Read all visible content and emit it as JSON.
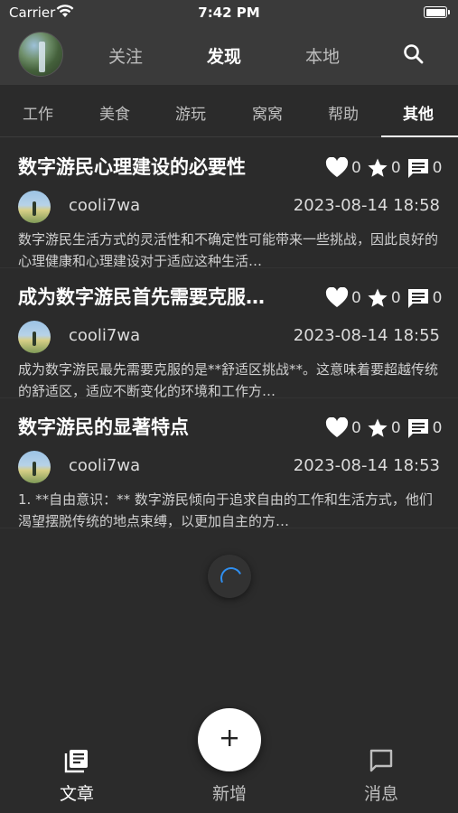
{
  "status_bar": {
    "carrier": "Carrier",
    "time": "7:42 PM"
  },
  "header": {
    "tabs": [
      {
        "label": "关注",
        "active": false
      },
      {
        "label": "发现",
        "active": true
      },
      {
        "label": "本地",
        "active": false
      }
    ],
    "search_icon": "search-icon"
  },
  "categories": [
    {
      "label": "工作",
      "active": false
    },
    {
      "label": "美食",
      "active": false
    },
    {
      "label": "游玩",
      "active": false
    },
    {
      "label": "窝窝",
      "active": false
    },
    {
      "label": "帮助",
      "active": false
    },
    {
      "label": "其他",
      "active": true
    }
  ],
  "articles": [
    {
      "title": "数字游民心理建设的必要性",
      "likes": "0",
      "stars": "0",
      "comments": "0",
      "author": "cooli7wa",
      "date": "2023-08-14 18:58",
      "excerpt": "数字游民生活方式的灵活性和不确定性可能带来一些挑战，因此良好的心理健康和心理建设对于适应这种生活…"
    },
    {
      "title": "成为数字游民首先需要克服…",
      "likes": "0",
      "stars": "0",
      "comments": "0",
      "author": "cooli7wa",
      "date": "2023-08-14 18:55",
      "excerpt": "成为数字游民最先需要克服的是**舒适区挑战**。这意味着要超越传统的舒适区，适应不断变化的环境和工作方…"
    },
    {
      "title": "数字游民的显著特点",
      "likes": "0",
      "stars": "0",
      "comments": "0",
      "author": "cooli7wa",
      "date": "2023-08-14 18:53",
      "excerpt": "1. **自由意识：** 数字游民倾向于追求自由的工作和生活方式，他们渴望摆脱传统的地点束缚，以更加自主的方…"
    }
  ],
  "bottom_nav": {
    "articles_label": "文章",
    "add_label": "新增",
    "messages_label": "消息"
  },
  "colors": {
    "header_bg": "#3a3a3a",
    "page_bg": "#2b2b2b",
    "spinner": "#2f8ff0"
  }
}
